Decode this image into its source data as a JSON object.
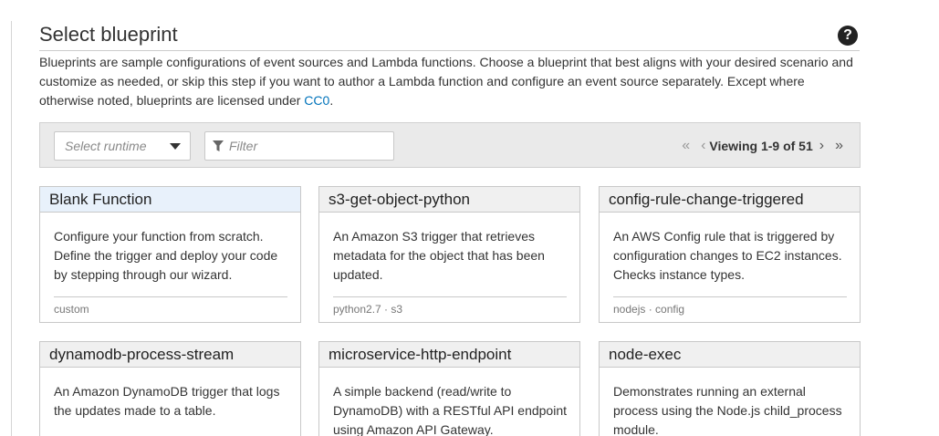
{
  "header": {
    "title": "Select blueprint",
    "help_icon": "question-circle-icon"
  },
  "intro": {
    "text_before_link": "Blueprints are sample configurations of event sources and Lambda functions. Choose a blueprint that best aligns with your desired scenario and customize as needed, or skip this step if you want to author a Lambda function and configure an event source separately. Except where otherwise noted, blueprints are licensed under ",
    "link_text": "CC0",
    "text_after_link": "."
  },
  "toolbar": {
    "runtime_placeholder": "Select runtime",
    "filter_placeholder": "Filter",
    "pager": {
      "first_icon": "double-chevron-left-icon",
      "prev_icon": "chevron-left-icon",
      "viewing_text": "Viewing 1-9 of 51",
      "next_icon": "chevron-right-icon",
      "last_icon": "double-chevron-right-icon"
    }
  },
  "blueprints": [
    {
      "title": "Blank Function",
      "description": "Configure your function from scratch. Define the trigger and deploy your code by stepping through our wizard.",
      "tags": "custom",
      "selected": true
    },
    {
      "title": "s3-get-object-python",
      "description": "An Amazon S3 trigger that retrieves metadata for the object that has been updated.",
      "tags": "python2.7 · s3"
    },
    {
      "title": "config-rule-change-triggered",
      "description": "An AWS Config rule that is triggered by configuration changes to EC2 instances. Checks instance types.",
      "tags": "nodejs · config"
    },
    {
      "title": "dynamodb-process-stream",
      "description": "An Amazon DynamoDB trigger that logs the updates made to a table."
    },
    {
      "title": "microservice-http-endpoint",
      "description": "A simple backend (read/write to DynamoDB) with a RESTful API endpoint using Amazon API Gateway."
    },
    {
      "title": "node-exec",
      "description": "Demonstrates running an external process using the Node.js child_process module."
    }
  ],
  "colors": {
    "link": "#0073bb",
    "selected_card_header": "#e8f1fb",
    "toolbar_bg": "#eaeaea"
  }
}
